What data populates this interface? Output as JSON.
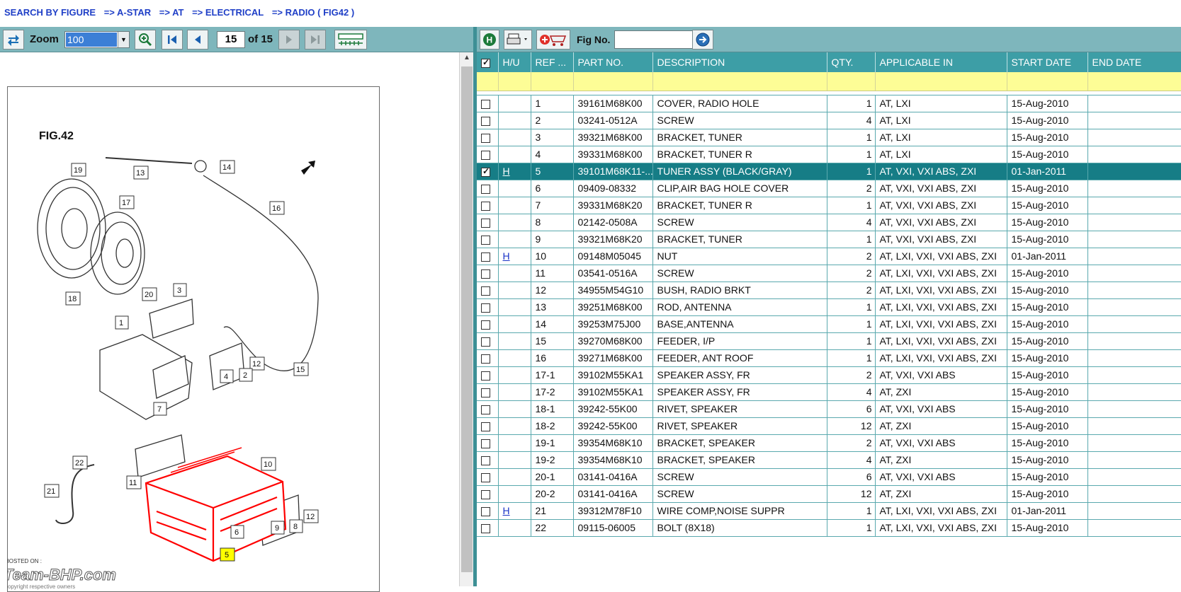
{
  "breadcrumb": [
    "SEARCH BY FIGURE",
    "=> A-STAR",
    "=> AT",
    "=> ELECTRICAL",
    "=> RADIO ( FIG42 )"
  ],
  "viewer": {
    "zoom_label": "Zoom",
    "zoom_value": "100",
    "page_current": "15",
    "page_total": "of 15"
  },
  "figure": {
    "title": "FIG.42",
    "callouts": [
      "19",
      "13",
      "14",
      "17",
      "16",
      "18",
      "20",
      "3",
      "1",
      "12",
      "4",
      "2",
      "15",
      "7",
      "22",
      "10",
      "11",
      "21",
      "12",
      "9",
      "8",
      "6",
      "5"
    ],
    "watermark_hosted": "HOSTED ON :",
    "watermark_brand": "Team-BHP.com",
    "watermark_sub": "copyright respective owners"
  },
  "parts_toolbar": {
    "figno_label": "Fig No.",
    "figno_value": ""
  },
  "table": {
    "columns": [
      "",
      "H/U",
      "REF ...",
      "PART NO.",
      "DESCRIPTION",
      "QTY.",
      "APPLICABLE IN",
      "START DATE",
      "END DATE"
    ],
    "rows": [
      {
        "checked": false,
        "hu": "",
        "ref": "1",
        "part": "39161M68K00",
        "desc": "COVER, RADIO HOLE",
        "qty": "1",
        "applicable": "AT, LXI",
        "start": "15-Aug-2010",
        "end": ""
      },
      {
        "checked": false,
        "hu": "",
        "ref": "2",
        "part": "03241-0512A",
        "desc": "SCREW",
        "qty": "4",
        "applicable": "AT, LXI",
        "start": "15-Aug-2010",
        "end": ""
      },
      {
        "checked": false,
        "hu": "",
        "ref": "3",
        "part": "39321M68K00",
        "desc": "BRACKET, TUNER",
        "qty": "1",
        "applicable": "AT, LXI",
        "start": "15-Aug-2010",
        "end": ""
      },
      {
        "checked": false,
        "hu": "",
        "ref": "4",
        "part": "39331M68K00",
        "desc": "BRACKET, TUNER R",
        "qty": "1",
        "applicable": "AT, LXI",
        "start": "15-Aug-2010",
        "end": ""
      },
      {
        "checked": true,
        "selected": true,
        "hu": "H",
        "ref": "5",
        "part": "39101M68K11-...",
        "desc": "TUNER ASSY (BLACK/GRAY)",
        "qty": "1",
        "applicable": "AT, VXI, VXI ABS, ZXI",
        "start": "01-Jan-2011",
        "end": ""
      },
      {
        "checked": false,
        "hu": "",
        "ref": "6",
        "part": "09409-08332",
        "desc": "CLIP,AIR BAG HOLE COVER",
        "qty": "2",
        "applicable": "AT, VXI, VXI ABS, ZXI",
        "start": "15-Aug-2010",
        "end": ""
      },
      {
        "checked": false,
        "hu": "",
        "ref": "7",
        "part": "39331M68K20",
        "desc": "BRACKET, TUNER R",
        "qty": "1",
        "applicable": "AT, VXI, VXI ABS, ZXI",
        "start": "15-Aug-2010",
        "end": ""
      },
      {
        "checked": false,
        "hu": "",
        "ref": "8",
        "part": "02142-0508A",
        "desc": "SCREW",
        "qty": "4",
        "applicable": "AT, VXI, VXI ABS, ZXI",
        "start": "15-Aug-2010",
        "end": ""
      },
      {
        "checked": false,
        "hu": "",
        "ref": "9",
        "part": "39321M68K20",
        "desc": "BRACKET, TUNER",
        "qty": "1",
        "applicable": "AT, VXI, VXI ABS, ZXI",
        "start": "15-Aug-2010",
        "end": ""
      },
      {
        "checked": false,
        "hu": "H",
        "ref": "10",
        "part": "09148M05045",
        "desc": "NUT",
        "qty": "2",
        "applicable": "AT, LXI, VXI, VXI ABS, ZXI",
        "start": "01-Jan-2011",
        "end": ""
      },
      {
        "checked": false,
        "hu": "",
        "ref": "11",
        "part": "03541-0516A",
        "desc": "SCREW",
        "qty": "2",
        "applicable": "AT, LXI, VXI, VXI ABS, ZXI",
        "start": "15-Aug-2010",
        "end": ""
      },
      {
        "checked": false,
        "hu": "",
        "ref": "12",
        "part": "34955M54G10",
        "desc": "BUSH, RADIO BRKT",
        "qty": "2",
        "applicable": "AT, LXI, VXI, VXI ABS, ZXI",
        "start": "15-Aug-2010",
        "end": ""
      },
      {
        "checked": false,
        "hu": "",
        "ref": "13",
        "part": "39251M68K00",
        "desc": "ROD, ANTENNA",
        "qty": "1",
        "applicable": "AT, LXI, VXI, VXI ABS, ZXI",
        "start": "15-Aug-2010",
        "end": ""
      },
      {
        "checked": false,
        "hu": "",
        "ref": "14",
        "part": "39253M75J00",
        "desc": "BASE,ANTENNA",
        "qty": "1",
        "applicable": "AT, LXI, VXI, VXI ABS, ZXI",
        "start": "15-Aug-2010",
        "end": ""
      },
      {
        "checked": false,
        "hu": "",
        "ref": "15",
        "part": "39270M68K00",
        "desc": "FEEDER, I/P",
        "qty": "1",
        "applicable": "AT, LXI, VXI, VXI ABS, ZXI",
        "start": "15-Aug-2010",
        "end": ""
      },
      {
        "checked": false,
        "hu": "",
        "ref": "16",
        "part": "39271M68K00",
        "desc": "FEEDER, ANT ROOF",
        "qty": "1",
        "applicable": "AT, LXI, VXI, VXI ABS, ZXI",
        "start": "15-Aug-2010",
        "end": ""
      },
      {
        "checked": false,
        "hu": "",
        "ref": "17-1",
        "part": "39102M55KA1",
        "desc": "SPEAKER ASSY, FR",
        "qty": "2",
        "applicable": "AT, VXI, VXI ABS",
        "start": "15-Aug-2010",
        "end": ""
      },
      {
        "checked": false,
        "hu": "",
        "ref": "17-2",
        "part": "39102M55KA1",
        "desc": "SPEAKER ASSY, FR",
        "qty": "4",
        "applicable": "AT, ZXI",
        "start": "15-Aug-2010",
        "end": ""
      },
      {
        "checked": false,
        "hu": "",
        "ref": "18-1",
        "part": "39242-55K00",
        "desc": "RIVET, SPEAKER",
        "qty": "6",
        "applicable": "AT, VXI, VXI ABS",
        "start": "15-Aug-2010",
        "end": ""
      },
      {
        "checked": false,
        "hu": "",
        "ref": "18-2",
        "part": "39242-55K00",
        "desc": "RIVET, SPEAKER",
        "qty": "12",
        "applicable": "AT, ZXI",
        "start": "15-Aug-2010",
        "end": ""
      },
      {
        "checked": false,
        "hu": "",
        "ref": "19-1",
        "part": "39354M68K10",
        "desc": "BRACKET, SPEAKER",
        "qty": "2",
        "applicable": "AT, VXI, VXI ABS",
        "start": "15-Aug-2010",
        "end": ""
      },
      {
        "checked": false,
        "hu": "",
        "ref": "19-2",
        "part": "39354M68K10",
        "desc": "BRACKET, SPEAKER",
        "qty": "4",
        "applicable": "AT, ZXI",
        "start": "15-Aug-2010",
        "end": ""
      },
      {
        "checked": false,
        "hu": "",
        "ref": "20-1",
        "part": "03141-0416A",
        "desc": "SCREW",
        "qty": "6",
        "applicable": "AT, VXI, VXI ABS",
        "start": "15-Aug-2010",
        "end": ""
      },
      {
        "checked": false,
        "hu": "",
        "ref": "20-2",
        "part": "03141-0416A",
        "desc": "SCREW",
        "qty": "12",
        "applicable": "AT, ZXI",
        "start": "15-Aug-2010",
        "end": ""
      },
      {
        "checked": false,
        "hu": "H",
        "ref": "21",
        "part": "39312M78F10",
        "desc": "WIRE COMP,NOISE SUPPR",
        "qty": "1",
        "applicable": "AT, LXI, VXI, VXI ABS, ZXI",
        "start": "01-Jan-2011",
        "end": ""
      },
      {
        "checked": false,
        "hu": "",
        "ref": "22",
        "part": "09115-06005",
        "desc": "BOLT (8X18)",
        "qty": "1",
        "applicable": "AT, LXI, VXI, VXI ABS, ZXI",
        "start": "15-Aug-2010",
        "end": ""
      }
    ]
  },
  "colors": {
    "toolbar": "#7eb6bc",
    "header": "#3d9ea6",
    "selected_row": "#167d86",
    "filter_row": "#fdfd96",
    "breadcrumb": "#1f3fc7",
    "highlight_part": "#ff0000",
    "highlight_callout": "#ffff00"
  }
}
